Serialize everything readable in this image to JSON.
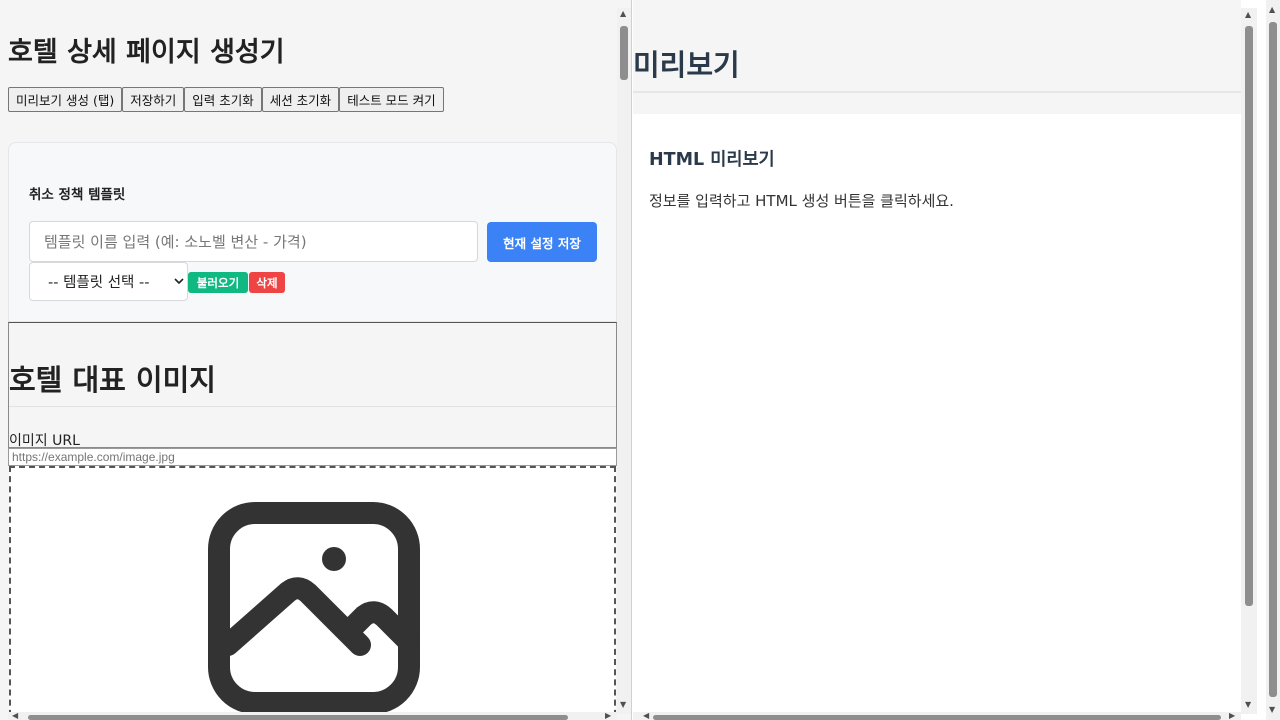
{
  "app": {
    "title": "호텔 상세 페이지 생성기"
  },
  "toolbar": {
    "buttons": [
      {
        "label": "미리보기 생성 (탭)"
      },
      {
        "label": "저장하기"
      },
      {
        "label": "입력 초기화"
      },
      {
        "label": "세션 초기화"
      },
      {
        "label": "테스트 모드 켜기"
      }
    ]
  },
  "template_card": {
    "heading": "취소 정책 템플릿",
    "name_input_placeholder": "템플릿 이름 입력 (예: 소노벨 변산 - 가격)",
    "name_input_value": "",
    "save_button_label": "현재 설정 저장",
    "select_value": "-- 템플릿 선택 --",
    "load_button_label": "불러오기",
    "delete_button_label": "삭제",
    "colors": {
      "save": "#3b82f6",
      "load": "#10b981",
      "delete": "#ef4444"
    }
  },
  "image_section": {
    "title": "호텔 대표 이미지",
    "url_label": "이미지 URL",
    "url_placeholder": "https://example.com/image.jpg",
    "url_value": "",
    "placeholder_icon": "image-icon"
  },
  "preview": {
    "title": "미리보기",
    "heading": "HTML 미리보기",
    "message": "정보를 입력하고 HTML 생성 버튼을 클릭하세요."
  }
}
